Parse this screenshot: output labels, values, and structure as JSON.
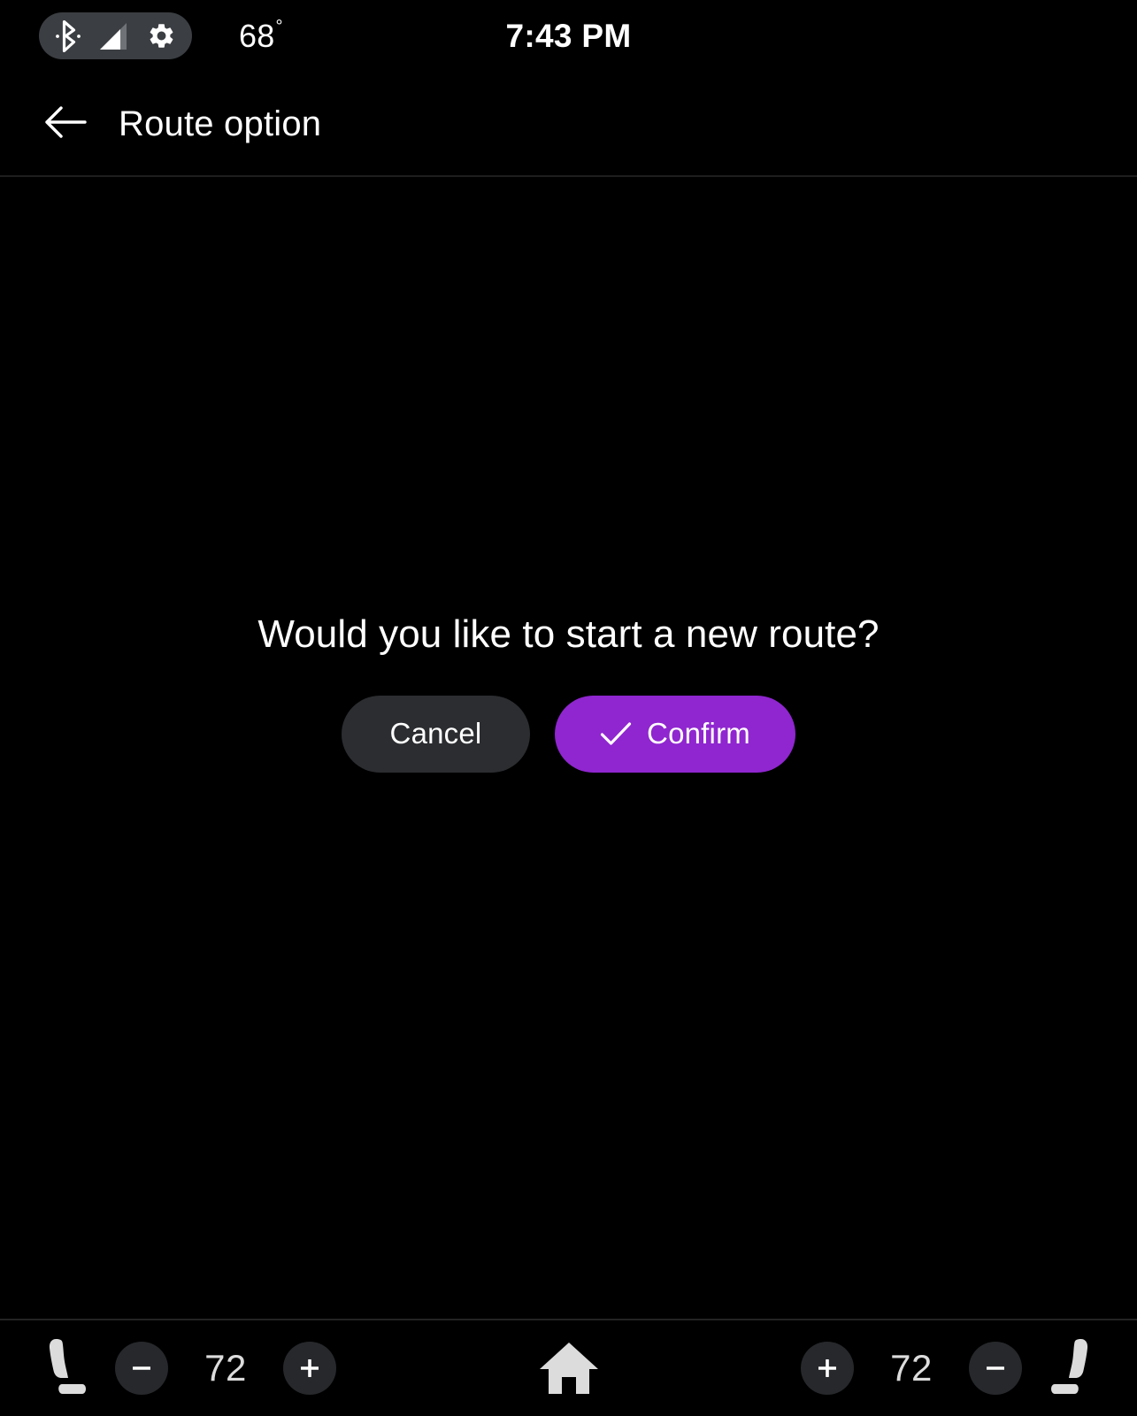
{
  "status_bar": {
    "icons": [
      {
        "name": "bluetooth-icon"
      },
      {
        "name": "signal-cellular-icon"
      },
      {
        "name": "settings-gear-icon"
      }
    ],
    "temperature": "68",
    "degree_symbol": "°",
    "time": "7:43 PM",
    "pill_color": "#3b3e42"
  },
  "header": {
    "back_icon": "back-arrow-icon",
    "title": "Route option"
  },
  "dialog": {
    "message": "Would you like to start a new route?",
    "cancel_label": "Cancel",
    "confirm_label": "Confirm",
    "confirm_icon": "check-icon",
    "confirm_color": "#8f26cf",
    "cancel_color": "#2b2d30"
  },
  "climate_bar": {
    "left": {
      "seat_icon": "seat-heater-left-icon",
      "decrease_icon": "minus-icon",
      "temperature": "72",
      "increase_icon": "plus-icon"
    },
    "home_icon": "home-icon",
    "right": {
      "increase_icon": "plus-icon",
      "temperature": "72",
      "decrease_icon": "minus-icon",
      "seat_icon": "seat-heater-right-icon"
    },
    "button_color": "#26282b"
  }
}
